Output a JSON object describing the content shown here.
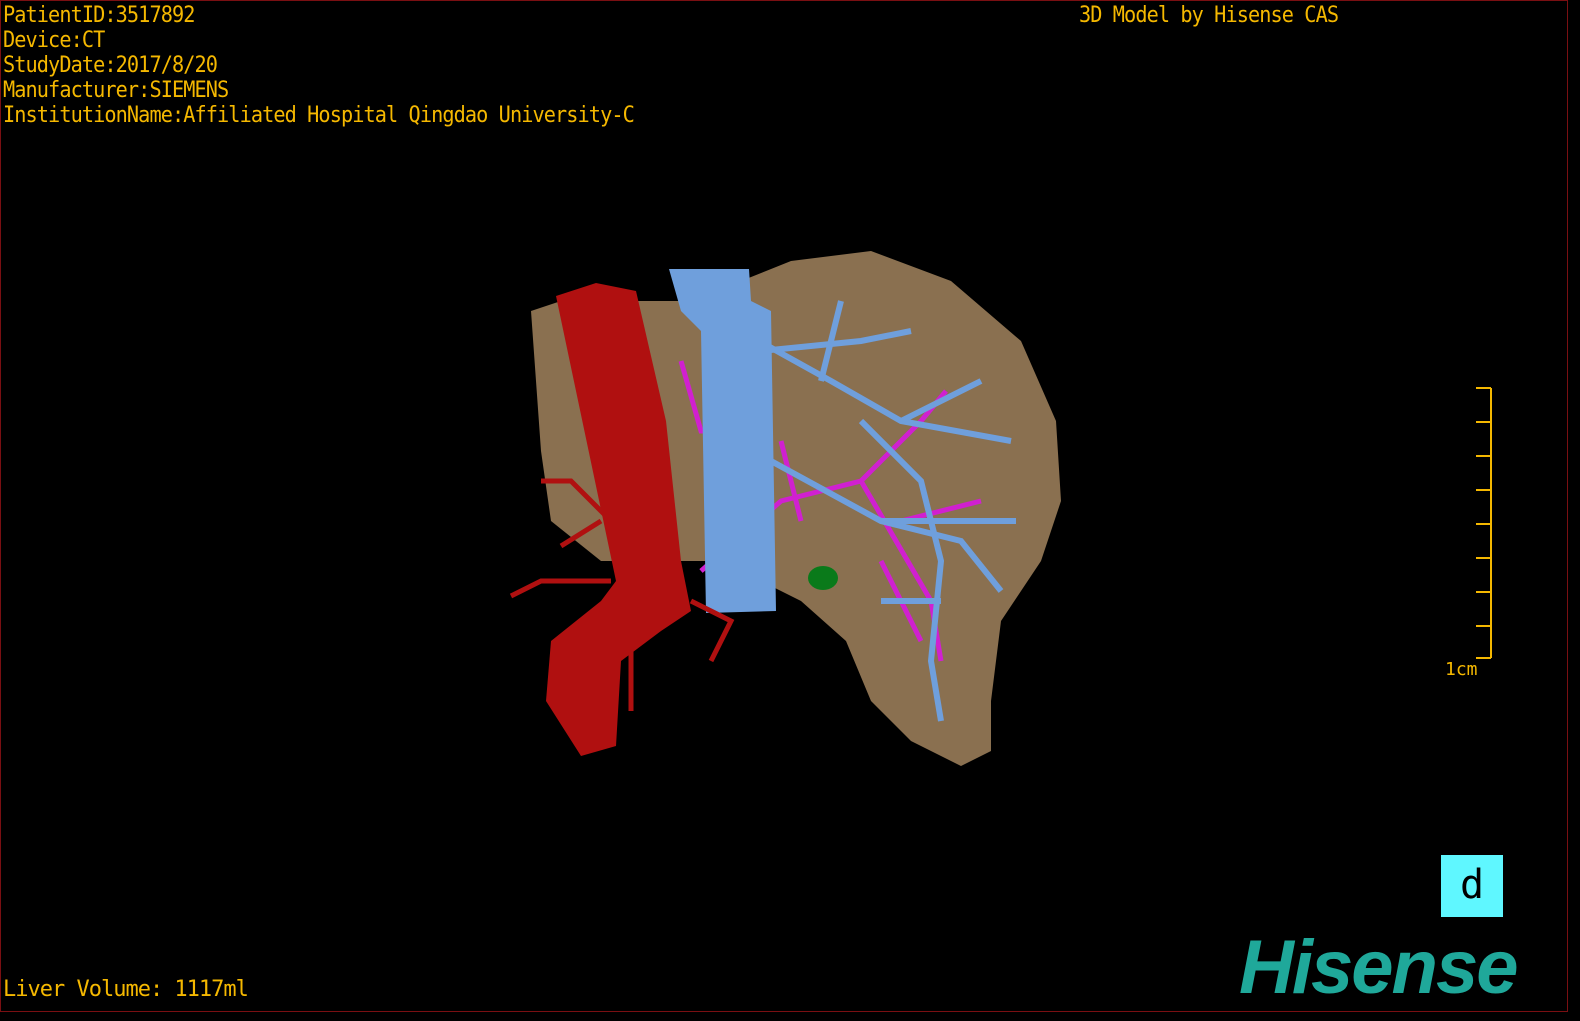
{
  "overlay": {
    "patient_id": "PatientID:3517892",
    "device": "Device:CT",
    "study_date": "StudyDate:2017/8/20",
    "manufacturer": "Manufacturer:SIEMENS",
    "institution": "InstitutionName:Affiliated Hospital Qingdao University-C",
    "model_credit": "3D Model by Hisense CAS",
    "liver_volume": "Liver Volume: 1117ml"
  },
  "scale_bar": {
    "label": "1cm"
  },
  "view_button": {
    "label": "d"
  },
  "logo": {
    "text": "Hisense"
  },
  "colors": {
    "text": "#f5b800",
    "liver": "#8a7050",
    "artery": "#b01010",
    "vein": "#6f9fdc",
    "portal": "#d020d0",
    "lesion": "#0a7a1a",
    "logo": "#1fa89a",
    "border": "#7a0f12"
  }
}
